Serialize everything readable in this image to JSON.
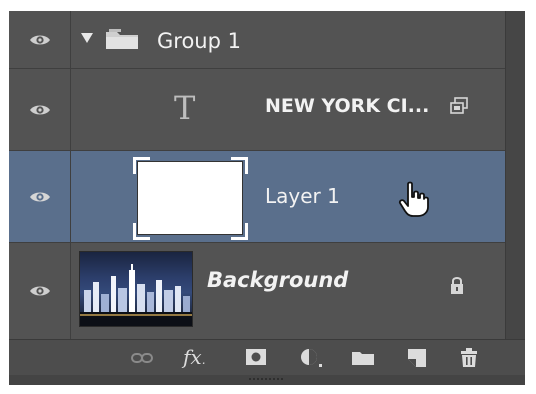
{
  "layers": [
    {
      "name": "Group 1",
      "type": "group"
    },
    {
      "name": "NEW YORK CI...",
      "type": "text",
      "type_glyph": "T"
    },
    {
      "name": "Layer 1",
      "type": "pixel",
      "selected": true
    },
    {
      "name": "Background",
      "type": "background",
      "locked": true
    }
  ],
  "toolbar": {
    "fx_label": "fx",
    "icons": [
      "link-icon",
      "fx-icon",
      "mask-icon",
      "adjustment-icon",
      "folder-icon",
      "new-layer-icon",
      "trash-icon"
    ]
  },
  "colors": {
    "panel_bg": "#535353",
    "selected_row": "#5a6f8c",
    "text": "#f2f2f2"
  }
}
